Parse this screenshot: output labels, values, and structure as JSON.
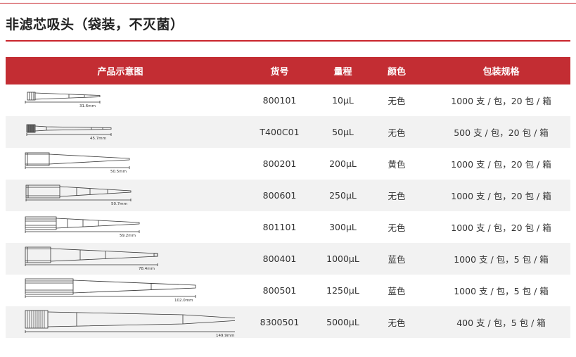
{
  "page": {
    "title": "非滤芯吸头（袋装，不灭菌）"
  },
  "table": {
    "headers": {
      "image": "产品示意图",
      "code": "货号",
      "range": "量程",
      "color": "颜色",
      "pack": "包装规格"
    },
    "rows": [
      {
        "dim": "31.6mm",
        "code": "800101",
        "range": "10µL",
        "color": "无色",
        "pack": "1000 支 / 包，20 包 / 箱"
      },
      {
        "dim": "45.7mm",
        "code": "T400C01",
        "range": "50µL",
        "color": "无色",
        "pack": "500 支 / 包，20 包 / 箱"
      },
      {
        "dim": "50.5mm",
        "code": "800201",
        "range": "200µL",
        "color": "黄色",
        "pack": "1000 支 / 包，20 包 / 箱"
      },
      {
        "dim": "50.7mm",
        "code": "800601",
        "range": "250µL",
        "color": "无色",
        "pack": "1000 支 / 包，20 包 / 箱"
      },
      {
        "dim": "59.2mm",
        "code": "801101",
        "range": "300µL",
        "color": "无色",
        "pack": "1000 支 / 包，20 包 / 箱"
      },
      {
        "dim": "78.4mm",
        "code": "800401",
        "range": "1000µL",
        "color": "蓝色",
        "pack": "1000 支 / 包，5 包 / 箱"
      },
      {
        "dim": "102.0mm",
        "code": "800501",
        "range": "1250µL",
        "color": "蓝色",
        "pack": "1000 支 / 包，5 包 / 箱"
      },
      {
        "dim": "149.9mm",
        "code": "8300501",
        "range": "5000µL",
        "color": "无色",
        "pack": "400 支 / 包，5 包 / 箱"
      }
    ]
  }
}
